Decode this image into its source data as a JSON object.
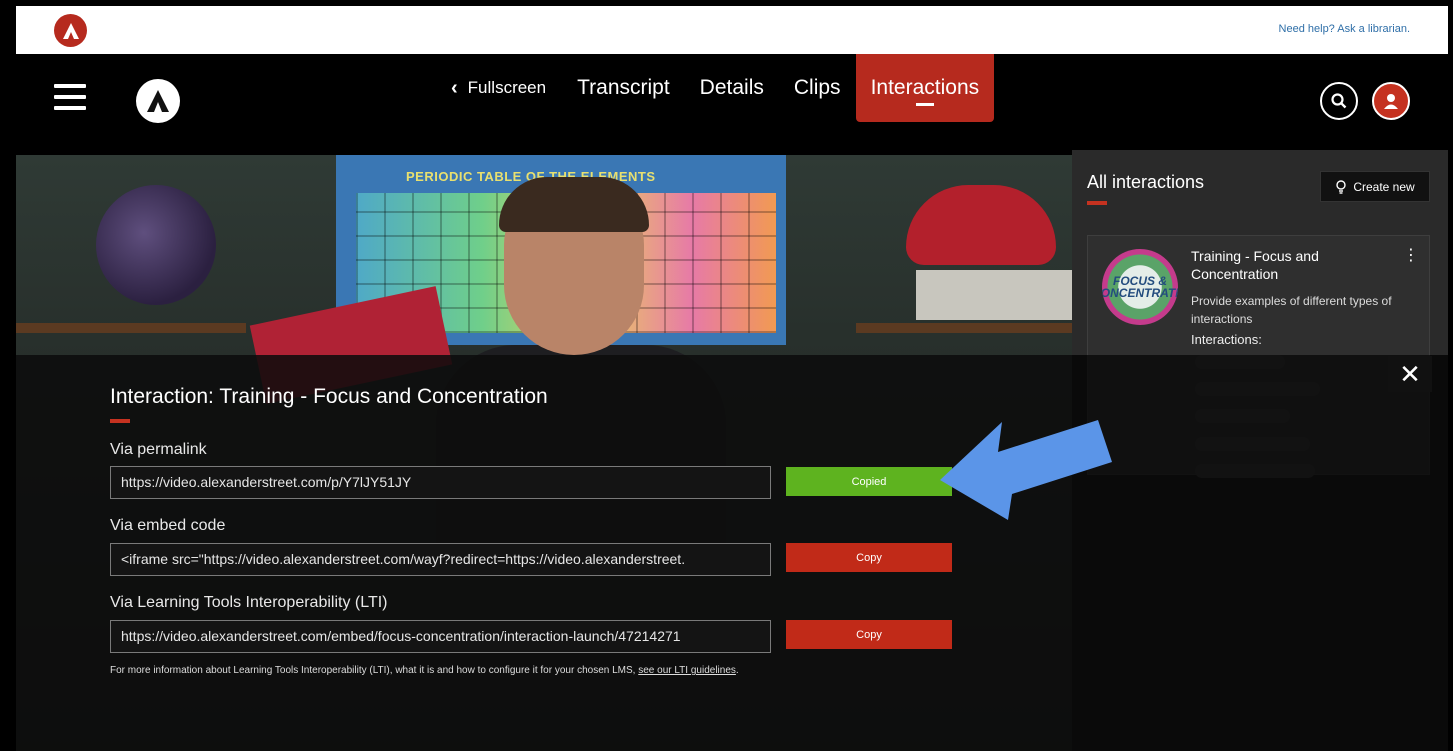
{
  "header": {
    "help_text": "Need help? Ask a librarian."
  },
  "nav": {
    "tabs": [
      {
        "label": "Fullscreen"
      },
      {
        "label": "Transcript"
      },
      {
        "label": "Details"
      },
      {
        "label": "Clips"
      },
      {
        "label": "Interactions"
      }
    ],
    "active_tab": "Interactions"
  },
  "video": {
    "poster_text": "PERIODIC TABLE OF THE ELEMENTS"
  },
  "modal": {
    "title": "Interaction: Training - Focus and Concentration",
    "permalink": {
      "label": "Via permalink",
      "value": "https://video.alexanderstreet.com/p/Y7lJY51JY",
      "button_label": "Copied"
    },
    "embed": {
      "label": "Via embed code",
      "value": "<iframe src=\"https://video.alexanderstreet.com/wayf?redirect=https://video.alexanderstreet.",
      "button_label": "Copy"
    },
    "lti": {
      "label": "Via Learning Tools Interoperability (LTI)",
      "value": "https://video.alexanderstreet.com/embed/focus-concentration/interaction-launch/47214271",
      "button_label": "Copy"
    },
    "footnote_text": "For more information about Learning Tools Interoperability (LTI), what it is and how to configure it for your chosen LMS,",
    "footnote_link": "see our LTI guidelines",
    "footnote_end": "."
  },
  "sidebar": {
    "title": "All interactions",
    "create_label": "Create new",
    "card": {
      "title": "Training - Focus and Concentration",
      "description": "Provide examples of different types of interactions",
      "interactions_label": "Interactions:",
      "thumb_text": "FOCUS & CONCENTRATIO"
    }
  },
  "colors": {
    "accent_red": "#c53220",
    "copied_green": "#5eb31f",
    "arrow_blue": "#5b95e8"
  }
}
